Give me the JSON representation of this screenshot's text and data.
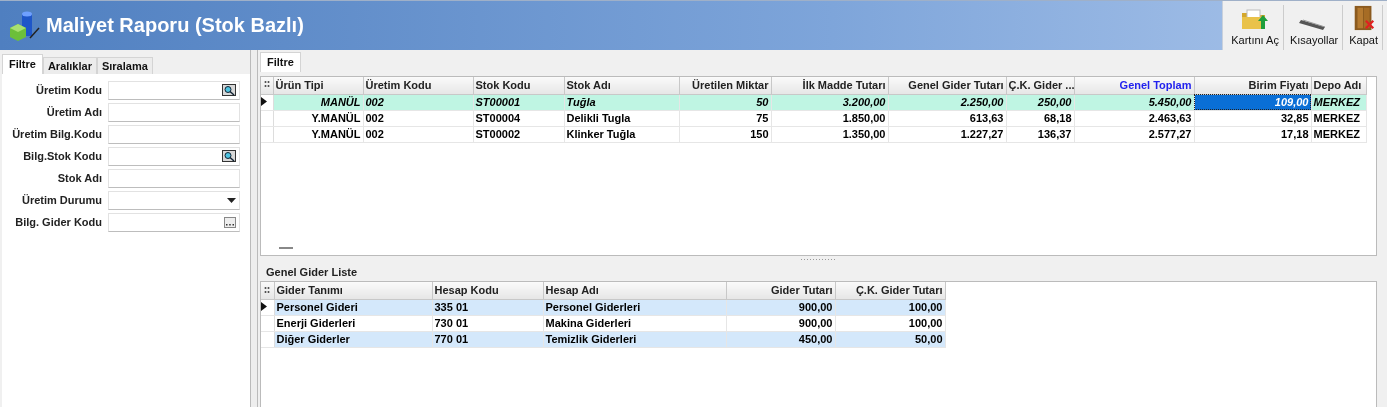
{
  "window": {
    "title": "Maliyet Raporu (Stok Bazlı)"
  },
  "toolbar": [
    {
      "kind": "open",
      "label": "Kartını Aç"
    },
    {
      "kind": "shortcuts",
      "label": "Kısayollar"
    },
    {
      "kind": "close",
      "label": "Kapat"
    }
  ],
  "left_tabs": [
    {
      "label": "Filtre",
      "selected": true
    },
    {
      "label": "Aralıklar",
      "selected": false
    },
    {
      "label": "Sıralama",
      "selected": false
    }
  ],
  "filter_fields": [
    {
      "label": "Üretim Kodu",
      "kind": "lookup"
    },
    {
      "label": "Üretim Adı",
      "kind": "text"
    },
    {
      "label": "Üretim Bilg.Kodu",
      "kind": "text"
    },
    {
      "label": "Bilg.Stok Kodu",
      "kind": "lookup"
    },
    {
      "label": "Stok Adı",
      "kind": "text"
    },
    {
      "label": "Üretim Durumu",
      "kind": "dropdown"
    },
    {
      "label": "Bilg. Gider Kodu",
      "kind": "ellipsis"
    }
  ],
  "right_tabs": [
    {
      "label": "Filtre",
      "selected": true
    }
  ],
  "cost_table": {
    "columns": [
      {
        "label": "Ürün Tipi",
        "highlighted": false,
        "focused": false
      },
      {
        "label": "Üretim Kodu",
        "highlighted": false,
        "focused": false
      },
      {
        "label": "Stok Kodu",
        "highlighted": false,
        "focused": false
      },
      {
        "label": "Stok Adı",
        "highlighted": false,
        "focused": false
      },
      {
        "label": "Üretilen Miktar",
        "highlighted": false,
        "focused": false
      },
      {
        "label": "İlk Madde Tutarı",
        "highlighted": false,
        "focused": false
      },
      {
        "label": "Genel Gider Tutarı",
        "highlighted": false,
        "focused": false
      },
      {
        "label": "Ç.K. Gider ...",
        "highlighted": false,
        "focused": false
      },
      {
        "label": "Genel Toplam",
        "highlighted": true,
        "focused": false
      },
      {
        "label": "Birim Fiyatı",
        "highlighted": false,
        "focused": true
      },
      {
        "label": "Depo Adı",
        "highlighted": false,
        "focused": false
      }
    ],
    "rows": [
      {
        "selected": true,
        "cells": [
          "MANÜL",
          "002",
          "ST00001",
          "Tuğla",
          "50",
          "3.200,00",
          "2.250,00",
          "250,00",
          "5.450,00",
          "109,00",
          "MERKEZ"
        ]
      },
      {
        "selected": false,
        "cells": [
          "Y.MANÜL",
          "002",
          "ST00004",
          "Delikli Tugla",
          "75",
          "1.850,00",
          "613,63",
          "68,18",
          "2.463,63",
          "32,85",
          "MERKEZ"
        ]
      },
      {
        "selected": false,
        "cells": [
          "Y.MANÜL",
          "002",
          "ST00002",
          "Klinker Tuğla",
          "150",
          "1.350,00",
          "1.227,27",
          "136,37",
          "2.577,27",
          "17,18",
          "MERKEZ"
        ]
      }
    ]
  },
  "expense_list": {
    "title": "Genel Gider Liste",
    "columns": [
      {
        "label": "Gider Tanımı"
      },
      {
        "label": "Hesap Kodu"
      },
      {
        "label": "Hesap Adı"
      },
      {
        "label": "Gider Tutarı"
      },
      {
        "label": "Ç.K. Gider Tutarı"
      }
    ],
    "rows": [
      {
        "selected": true,
        "cells": [
          "Personel Gideri",
          "335 01",
          "Personel Giderleri",
          "900,00",
          "100,00"
        ]
      },
      {
        "selected": false,
        "cells": [
          "Enerji Giderleri",
          "730 01",
          "Makina Giderleri",
          "900,00",
          "100,00"
        ]
      },
      {
        "selected": false,
        "cells": [
          "Diğer Giderler",
          "770 01",
          "Temizlik Giderleri",
          "450,00",
          "50,00"
        ]
      }
    ]
  }
}
